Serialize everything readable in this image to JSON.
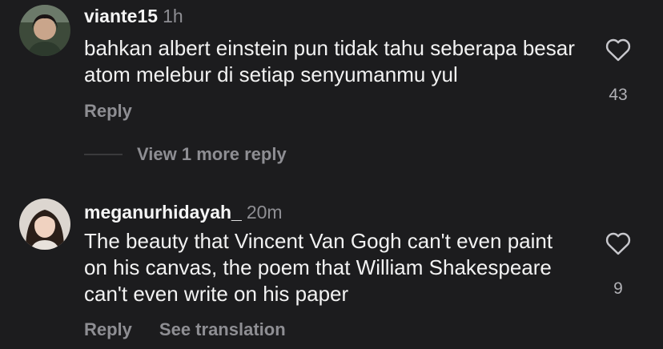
{
  "comments": [
    {
      "username": "viante15",
      "time": "1h",
      "text": "bahkan albert einstein pun tidak tahu seberapa besar atom melebur di setiap senyumanmu yul",
      "likes": "43",
      "actions": {
        "reply": "Reply"
      },
      "view_more": "View 1 more reply",
      "like_icon": "heart-outline-icon"
    },
    {
      "username": "meganurhidayah_",
      "time": "20m",
      "text": "The beauty that Vincent Van Gogh can't even paint on his canvas, the poem that William Shakespeare can't even write on his paper",
      "likes": "9",
      "actions": {
        "reply": "Reply",
        "translate": "See translation"
      },
      "like_icon": "heart-outline-icon"
    }
  ],
  "colors": {
    "background": "#1c1c1e",
    "primary_text": "#f5f5f5",
    "secondary_text": "#8e8e93"
  }
}
